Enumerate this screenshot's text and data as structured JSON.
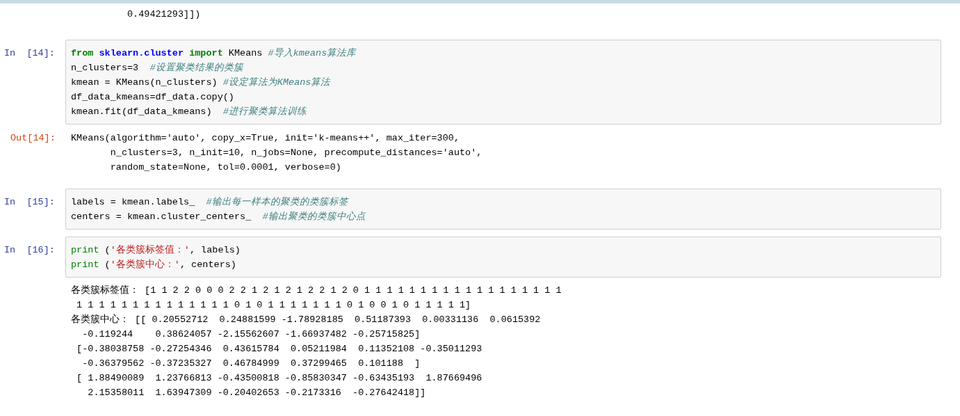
{
  "previous_output": {
    "lines": [
      "          0.49421293]])"
    ]
  },
  "cells": [
    {
      "kind": "input",
      "prompt": "In  [14]:",
      "lines": [
        [
          {
            "text": "from",
            "kind": "keyword"
          },
          {
            "text": " sklearn.cluster",
            "kind": "module"
          },
          {
            "text": " import",
            "kind": "keyword"
          },
          {
            "text": " KMeans ",
            "kind": "plain"
          },
          {
            "text": "#导入kmeans算法库",
            "kind": "comment"
          }
        ],
        [
          {
            "text": "n_clusters=3  ",
            "kind": "plain"
          },
          {
            "text": "#设置聚类结果的类簇",
            "kind": "comment"
          }
        ],
        [
          {
            "text": "kmean = KMeans(n_clusters) ",
            "kind": "plain"
          },
          {
            "text": "#设定算法为KMeans算法",
            "kind": "comment"
          }
        ],
        [
          {
            "text": "df_data_kmeans=df_data.copy()",
            "kind": "plain"
          }
        ],
        [
          {
            "text": "kmean.fit(df_data_kmeans)  ",
            "kind": "plain"
          },
          {
            "text": "#进行聚类算法训练",
            "kind": "comment"
          }
        ]
      ]
    },
    {
      "kind": "result",
      "prompt": "Out[14]:",
      "lines": [
        "KMeans(algorithm='auto', copy_x=True, init='k-means++', max_iter=300,",
        "       n_clusters=3, n_init=10, n_jobs=None, precompute_distances='auto',",
        "       random_state=None, tol=0.0001, verbose=0)"
      ]
    },
    {
      "kind": "input",
      "prompt": "In  [15]:",
      "lines": [
        [
          {
            "text": "labels = kmean.labels_  ",
            "kind": "plain"
          },
          {
            "text": "#输出每一样本的聚类的类簇标签",
            "kind": "comment"
          }
        ],
        [
          {
            "text": "centers = kmean.cluster_centers_  ",
            "kind": "plain"
          },
          {
            "text": "#输出聚类的类簇中心点",
            "kind": "comment"
          }
        ]
      ]
    },
    {
      "kind": "input",
      "prompt": "In  [16]:",
      "lines": [
        [
          {
            "text": "print",
            "kind": "builtin"
          },
          {
            "text": " (",
            "kind": "plain"
          },
          {
            "text": "'各类簇标签值：'",
            "kind": "string"
          },
          {
            "text": ", labels)",
            "kind": "plain"
          }
        ],
        [
          {
            "text": "print",
            "kind": "builtin"
          },
          {
            "text": " (",
            "kind": "plain"
          },
          {
            "text": "'各类簇中心：'",
            "kind": "string"
          },
          {
            "text": ", centers)",
            "kind": "plain"
          }
        ]
      ]
    },
    {
      "kind": "stream",
      "lines": [
        "各类簇标签值： [1 1 2 2 0 0 0 2 2 1 2 1 2 1 2 2 1 2 0 1 1 1 1 1 1 1 1 1 1 1 1 1 1 1 1 1 1",
        " 1 1 1 1 1 1 1 1 1 1 1 1 1 1 0 1 0 1 1 1 1 1 1 1 0 1 0 0 1 0 1 1 1 1 1]",
        "各类簇中心： [[ 0.20552712  0.24881599 -1.78928185  0.51187393  0.00331136  0.0615392",
        "  -0.119244    0.38624057 -2.15562607 -1.66937482 -0.25715825]",
        " [-0.38038758 -0.27254346  0.43615784  0.05211984  0.11352108 -0.35011293",
        "  -0.36379562 -0.37235327  0.46784999  0.37299465  0.101188  ]",
        " [ 1.88490089  1.23766813 -0.43500818 -0.85830347 -0.63435193  1.87669496",
        "   2.15358011  1.63947309 -0.20402653 -0.2173316  -0.27642418]]"
      ]
    }
  ]
}
